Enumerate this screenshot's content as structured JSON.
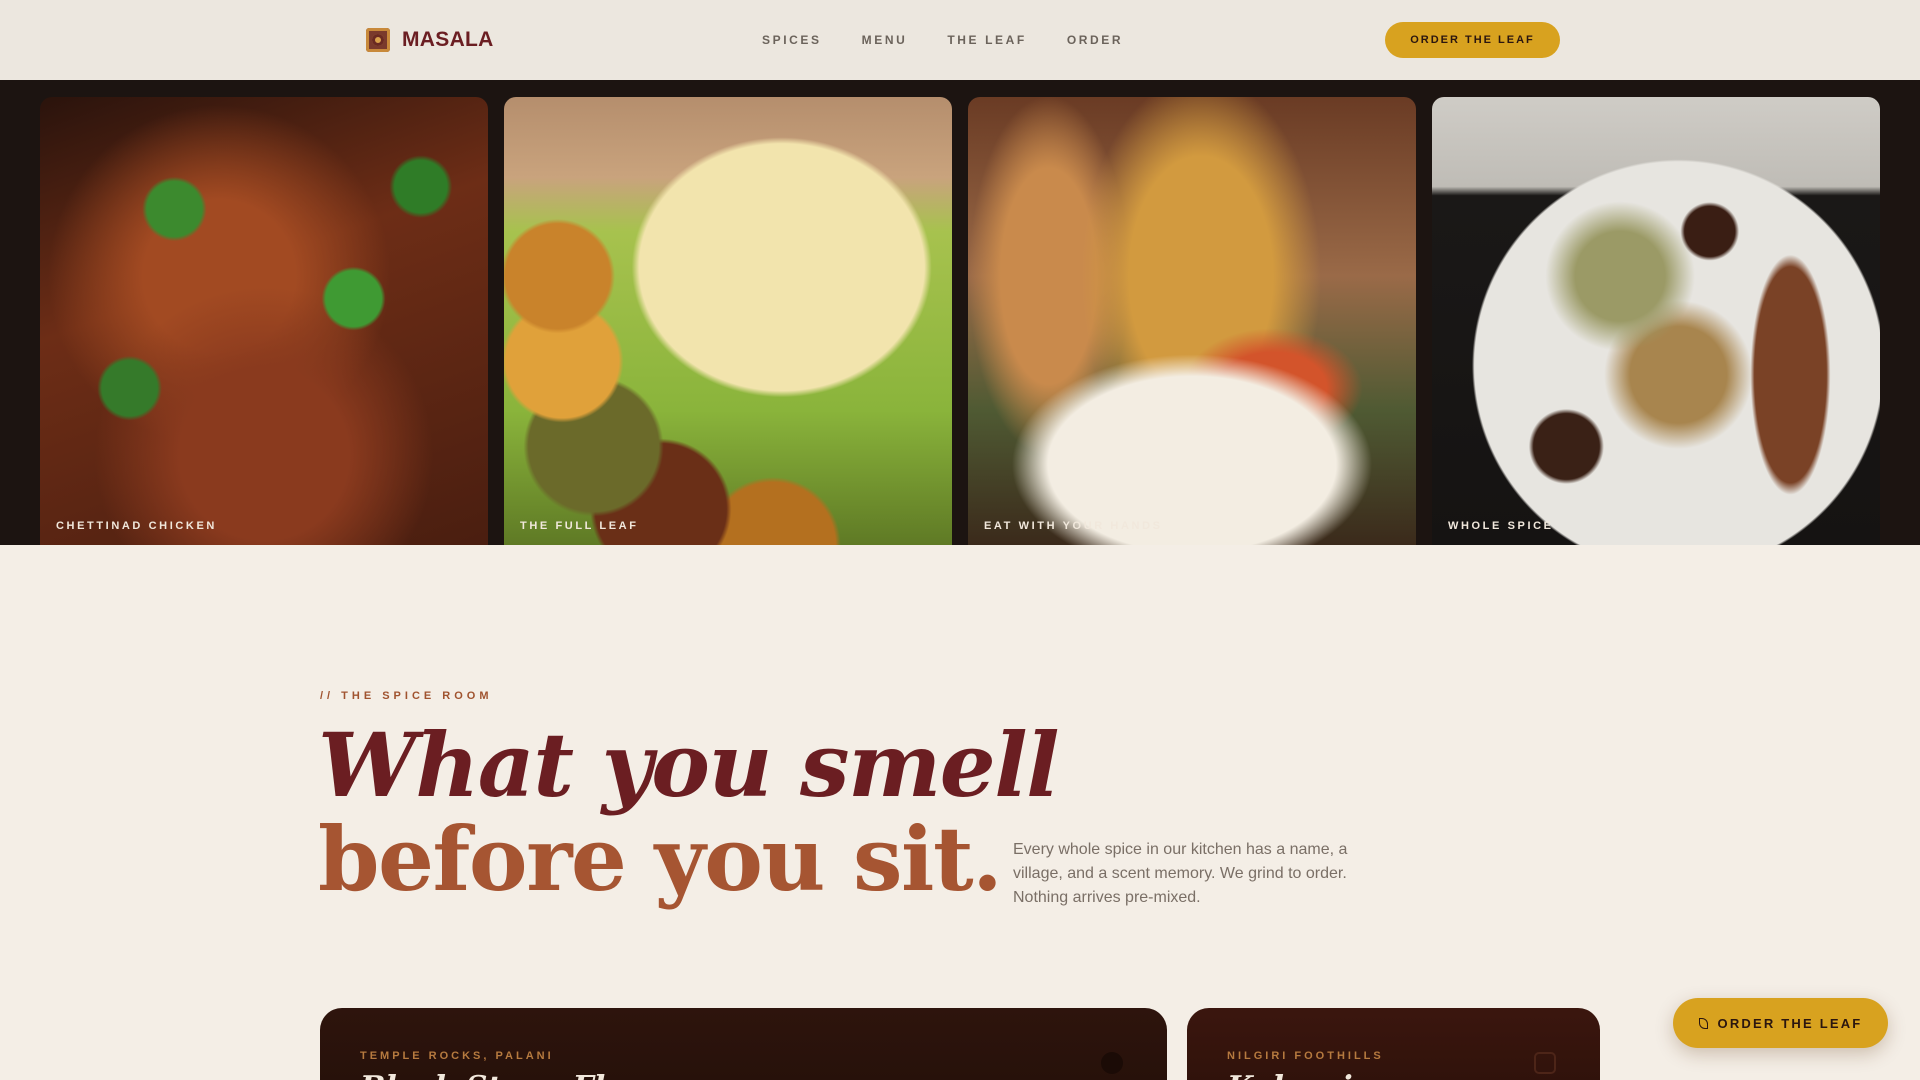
{
  "brand": {
    "name": "MASALA",
    "logo_icon": "mandala-icon"
  },
  "nav": {
    "items": [
      "SPICES",
      "MENU",
      "THE LEAF",
      "ORDER"
    ]
  },
  "header_cta": {
    "label": "ORDER THE LEAF"
  },
  "gallery": {
    "tiles": [
      {
        "caption": "CHETTINAD CHICKEN"
      },
      {
        "caption": "THE FULL LEAF"
      },
      {
        "caption": "EAT WITH YOUR HANDS"
      },
      {
        "caption": "WHOLE SPICE"
      }
    ]
  },
  "spice_room": {
    "eyebrow": "// THE SPICE ROOM",
    "headline_line1": "What you smell",
    "headline_line2": "before you sit.",
    "lede": "Every whole spice in our kitchen has a name, a village, and a scent memory. We grind to order. Nothing arrives pre-mixed."
  },
  "cards": [
    {
      "origin": "TEMPLE ROCKS, PALANI",
      "title": "Black Stone Fl"
    },
    {
      "origin": "NILGIRI FOOTHILLS",
      "title": "Kalpasi"
    }
  ],
  "floating_cta": {
    "label": "ORDER THE LEAF",
    "icon": "leaf-icon"
  },
  "colors": {
    "accent": "#d8a21f",
    "brand": "#6b1e22",
    "rust": "#a65532",
    "dark": "#1c1411",
    "background": "#f4eee6"
  }
}
